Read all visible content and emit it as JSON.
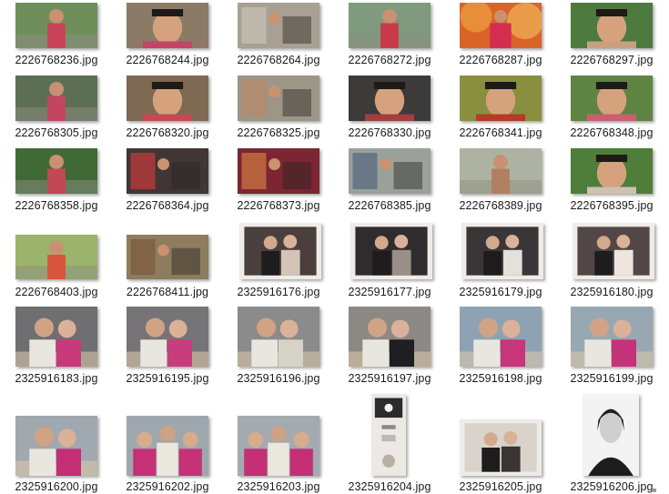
{
  "files": [
    {
      "name": "2226768236.jpg",
      "bg": "#6f8f5a",
      "acc": "#c9435a",
      "kind": "person"
    },
    {
      "name": "2226768244.jpg",
      "bg": "#8b7a66",
      "acc": "#c44466",
      "kind": "face"
    },
    {
      "name": "2226768264.jpg",
      "bg": "#a8a093",
      "acc": "#c7c2b8",
      "kind": "scene"
    },
    {
      "name": "2226768272.jpg",
      "bg": "#7f9a7d",
      "acc": "#c83a4a",
      "kind": "person"
    },
    {
      "name": "2226768287.jpg",
      "bg": "#d8642a",
      "acc": "#f0a040",
      "kind": "fire"
    },
    {
      "name": "2226768297.jpg",
      "bg": "#4d7b3f",
      "acc": "#c8a080",
      "kind": "face"
    },
    {
      "name": "2226768305.jpg",
      "bg": "#5c6f54",
      "acc": "#c34561",
      "kind": "person"
    },
    {
      "name": "2226768320.jpg",
      "bg": "#7e6a52",
      "acc": "#c34a52",
      "kind": "face"
    },
    {
      "name": "2226768325.jpg",
      "bg": "#9d9586",
      "acc": "#b88a66",
      "kind": "scene"
    },
    {
      "name": "2226768330.jpg",
      "bg": "#3d3a3a",
      "acc": "#a04040",
      "kind": "face"
    },
    {
      "name": "2226768341.jpg",
      "bg": "#8a8f40",
      "acc": "#b43a2a",
      "kind": "face"
    },
    {
      "name": "2226768348.jpg",
      "bg": "#5e8444",
      "acc": "#c86070",
      "kind": "face"
    },
    {
      "name": "2226768358.jpg",
      "bg": "#3f6a35",
      "acc": "#c24858",
      "kind": "person"
    },
    {
      "name": "2226768364.jpg",
      "bg": "#403635",
      "acc": "#c43c3c",
      "kind": "scene"
    },
    {
      "name": "2226768373.jpg",
      "bg": "#7b2632",
      "acc": "#d07a40",
      "kind": "scene"
    },
    {
      "name": "2226768385.jpg",
      "bg": "#9aa19a",
      "acc": "#55657f",
      "kind": "scene"
    },
    {
      "name": "2226768389.jpg",
      "bg": "#aeb2a2",
      "acc": "#b08060",
      "kind": "person"
    },
    {
      "name": "2226768395.jpg",
      "bg": "#4e7e39",
      "acc": "#d0c0b0",
      "kind": "face"
    },
    {
      "name": "2226768403.jpg",
      "bg": "#9bb36b",
      "acc": "#d6553a",
      "kind": "person"
    },
    {
      "name": "2226768411.jpg",
      "bg": "#8d7d5e",
      "acc": "#7a5a3a",
      "kind": "scene"
    },
    {
      "name": "2325916176.jpg",
      "bg": "#4a3f3d",
      "acc": "#d4c4b8",
      "kind": "photo"
    },
    {
      "name": "2325916177.jpg",
      "bg": "#2f2c2e",
      "acc": "#9a8f86",
      "kind": "photo"
    },
    {
      "name": "2325916179.jpg",
      "bg": "#3a3638",
      "acc": "#e4e0dc",
      "kind": "photo"
    },
    {
      "name": "2325916180.jpg",
      "bg": "#524746",
      "acc": "#ede6df",
      "kind": "photo"
    },
    {
      "name": "2325916183.jpg",
      "bg": "#6f6e70",
      "acc": "#c93a7a",
      "kind": "couple"
    },
    {
      "name": "2325916195.jpg",
      "bg": "#767476",
      "acc": "#c83d7d",
      "kind": "couple"
    },
    {
      "name": "2325916196.jpg",
      "bg": "#8a8b8a",
      "acc": "#d7d2c8",
      "kind": "couple"
    },
    {
      "name": "2325916197.jpg",
      "bg": "#8c8984",
      "acc": "#1f1f23",
      "kind": "couple"
    },
    {
      "name": "2325916198.jpg",
      "bg": "#8fa2b3",
      "acc": "#c7357b",
      "kind": "couple"
    },
    {
      "name": "2325916199.jpg",
      "bg": "#98a8b2",
      "acc": "#c4327a",
      "kind": "couple"
    },
    {
      "name": "2325916200.jpg",
      "bg": "#a0a8b0",
      "acc": "#c32e77",
      "kind": "couple"
    },
    {
      "name": "2325916202.jpg",
      "bg": "#9fa7ae",
      "acc": "#c53176",
      "kind": "trio"
    },
    {
      "name": "2325916203.jpg",
      "bg": "#a3aab0",
      "acc": "#c42f76",
      "kind": "trio"
    },
    {
      "name": "2325916204.jpg",
      "bg": "#ece9e4",
      "acc": "#2b2b2b",
      "kind": "card"
    },
    {
      "name": "2325916205.jpg",
      "bg": "#d8d3cb",
      "acc": "#3a3432",
      "kind": "photo"
    },
    {
      "name": "2325916206.jpg",
      "bg": "#f3f3f3",
      "acc": "#202020",
      "kind": "id"
    }
  ]
}
